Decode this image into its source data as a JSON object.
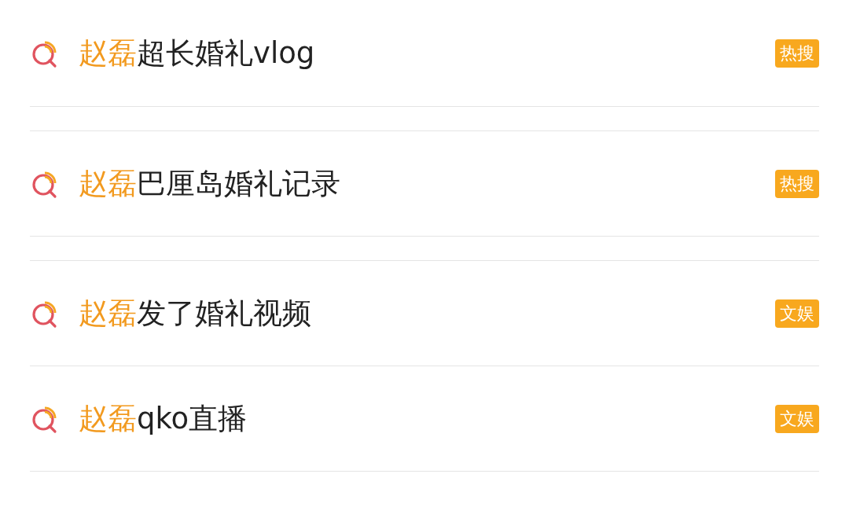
{
  "suggestions": [
    {
      "highlight": "赵磊",
      "rest": "超长婚礼vlog",
      "badge": "热搜"
    },
    {
      "highlight": "赵磊",
      "rest": "巴厘岛婚礼记录",
      "badge": "热搜"
    },
    {
      "highlight": "赵磊",
      "rest": "发了婚礼视频",
      "badge": "文娱"
    },
    {
      "highlight": "赵磊",
      "rest": "qko直播",
      "badge": "文娱"
    }
  ]
}
